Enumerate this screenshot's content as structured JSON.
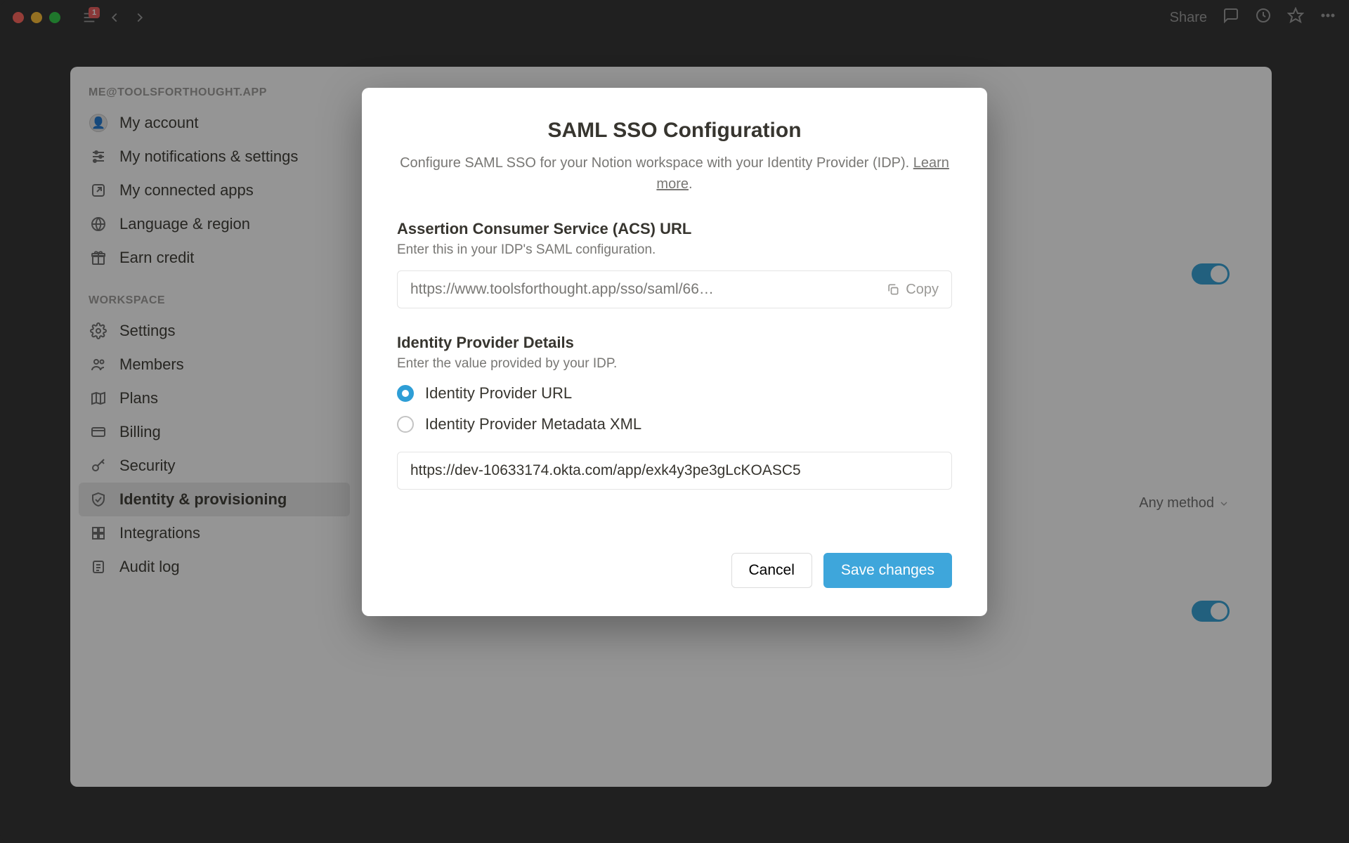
{
  "titlebar": {
    "badge_count": "1",
    "share_label": "Share"
  },
  "sidebar": {
    "section_account_label": "ME@TOOLSFORTHOUGHT.APP",
    "section_workspace_label": "WORKSPACE",
    "items_account": [
      {
        "name": "my-account",
        "label": "My account"
      },
      {
        "name": "my-notifications",
        "label": "My notifications & settings"
      },
      {
        "name": "my-connected-apps",
        "label": "My connected apps"
      },
      {
        "name": "language-region",
        "label": "Language & region"
      },
      {
        "name": "earn-credit",
        "label": "Earn credit"
      }
    ],
    "items_workspace": [
      {
        "name": "settings",
        "label": "Settings"
      },
      {
        "name": "members",
        "label": "Members"
      },
      {
        "name": "plans",
        "label": "Plans"
      },
      {
        "name": "billing",
        "label": "Billing"
      },
      {
        "name": "security",
        "label": "Security"
      },
      {
        "name": "identity-provisioning",
        "label": "Identity & provisioning",
        "active": true
      },
      {
        "name": "integrations",
        "label": "Integrations"
      },
      {
        "name": "audit-log",
        "label": "Audit log"
      }
    ]
  },
  "main": {
    "login_method_label": "Any method"
  },
  "modal": {
    "title": "SAML SSO Configuration",
    "subtitle_before": "Configure SAML SSO for your Notion workspace with your Identity Provider (IDP). ",
    "learn_more": "Learn more",
    "subtitle_after": ".",
    "acs_heading": "Assertion Consumer Service (ACS) URL",
    "acs_hint": "Enter this in your IDP's SAML configuration.",
    "acs_value": "https://www.toolsforthought.app/sso/saml/66…",
    "copy_label": "Copy",
    "idp_heading": "Identity Provider Details",
    "idp_hint": "Enter the value provided by your IDP.",
    "radio_url_label": "Identity Provider URL",
    "radio_xml_label": "Identity Provider Metadata XML",
    "idp_url_value": "https://dev-10633174.okta.com/app/exk4y3pe3gLcKOASC5",
    "cancel_label": "Cancel",
    "save_label": "Save changes"
  }
}
